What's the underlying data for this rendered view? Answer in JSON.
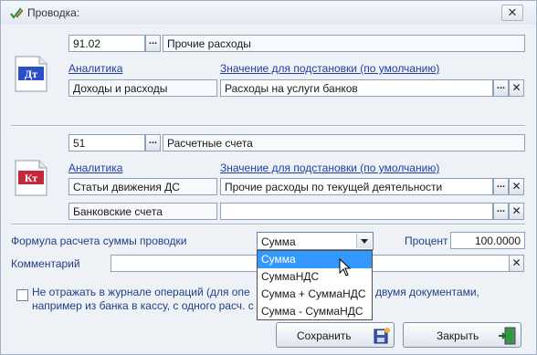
{
  "window": {
    "title": "Проводка:",
    "close_icon": "close-icon",
    "icon": "pencil-check-icon"
  },
  "debit": {
    "badge": "Дт",
    "account_code": "91.02",
    "account_name": "Прочие расходы",
    "analytics_link": "Аналитика",
    "default_link": "Значение для подстановки (по умолчанию)",
    "rows": [
      {
        "analytic": "Доходы и расходы",
        "value": "Расходы на услуги банков"
      }
    ]
  },
  "credit": {
    "badge": "Кт",
    "account_code": "51",
    "account_name": "Расчетные счета",
    "analytics_link": "Аналитика",
    "default_link": "Значение для подстановки (по умолчанию)",
    "rows": [
      {
        "analytic": "Статьи движения ДС",
        "value": "Прочие расходы по текущей деятельности"
      },
      {
        "analytic": "Банковские счета",
        "value": ""
      }
    ]
  },
  "formula": {
    "label": "Формула расчета суммы проводки",
    "selected": "Сумма",
    "options": [
      "Сумма",
      "СуммаНДС",
      "Сумма + СуммаНДС",
      "Сумма - СуммаНДС"
    ],
    "highlighted_index": 0
  },
  "percent": {
    "label": "Процент",
    "value": "100.0000"
  },
  "comment": {
    "label": "Комментарий",
    "value": ""
  },
  "journal_note": {
    "line1_left": "Не отражать в журнале операций (для опе",
    "line1_right": "двумя документами,",
    "line2_left": "например из банка в кассу, с одного расч. с"
  },
  "buttons": {
    "ellipsis": "...",
    "clear": "✕",
    "save": "Сохранить",
    "close": "Закрыть"
  },
  "colors": {
    "link": "#1f3fa3",
    "selection": "#3399ff",
    "debit_badge": "#2a4fc9",
    "credit_badge": "#c4283a"
  }
}
